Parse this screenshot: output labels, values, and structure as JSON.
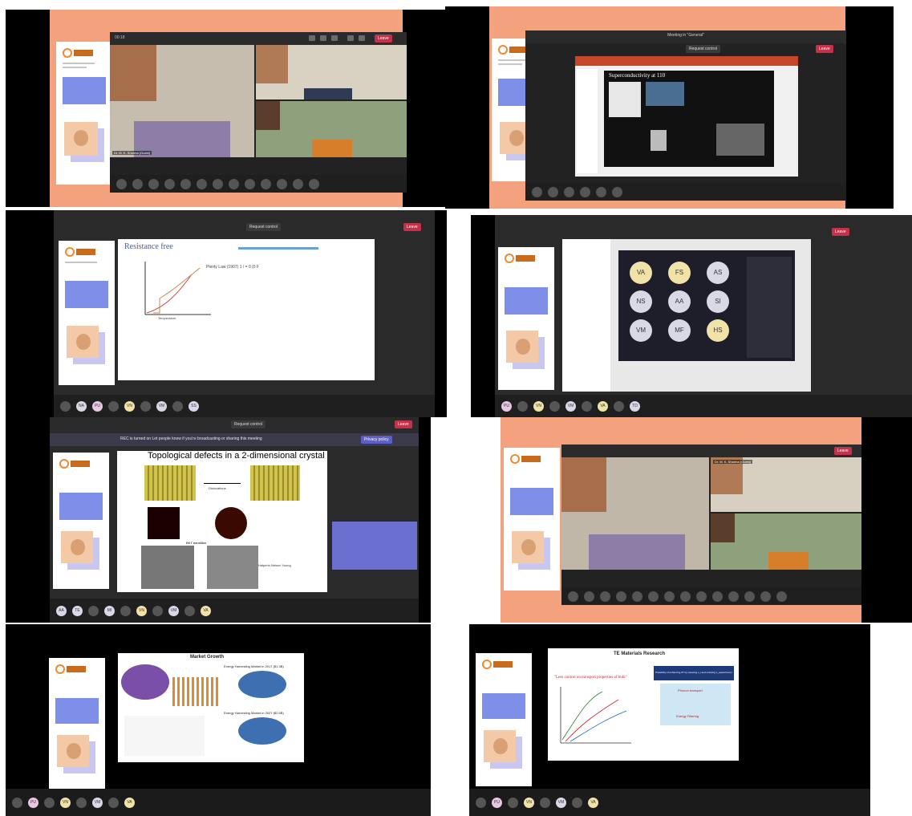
{
  "panels": {
    "p1": {
      "leave_label": "Leave",
      "presenter_tag": "Dr. M. K. Sharma (Guest)"
    },
    "p2": {
      "window_title": "Meeting in \"General\"",
      "request_control": "Request control",
      "leave_label": "Leave",
      "slide_title": "Superconductivity at 110"
    },
    "p3": {
      "request_control": "Request control",
      "leave_label": "Leave",
      "slide_title": "Resistance free",
      "slide_note": "Plenty Law (1907) 1 / = 0 (0 F",
      "x_axis": "Temperature"
    },
    "p4": {
      "leave_label": "Leave",
      "avatars": [
        "VA",
        "FS",
        "AS",
        "NS",
        "AA",
        "SI",
        "VM",
        "MF",
        "HS"
      ]
    },
    "p5": {
      "request_control": "Request control",
      "banner": "REC is turned on  Let people know if you're broadcasting or sharing this meeting",
      "privacy_button": "Privacy policy",
      "slide_title": "Topological defects in a 2-dimensional crystal",
      "arrow_label": "Dislocations",
      "transition_label": "BKT transition",
      "side_note": "Halperin Nelson Young"
    },
    "p6": {
      "leave_label": "Leave",
      "presenter_tag": "Dr. M. K. Sharma (Guest)"
    },
    "p7": {
      "slide_title": "Market Growth",
      "chart1_title": "Energy Harvesting Market in 2017 ($1.3B)",
      "chart2_title": "Energy Harvesting Market in 2027 ($2.6B)"
    },
    "p8": {
      "slide_title": "TE Materials Research",
      "quote": "\"Less control on transport properties of bulk\"",
      "box_text": "Possibility of enhancing ZT by reducing κ_l and reducing κ_e(electronic)",
      "diagram_label1": "Phonon transport",
      "diagram_label2": "Energy Filtering"
    }
  },
  "strip_avatars": {
    "p1": [
      "",
      "",
      "",
      "",
      "",
      "",
      "",
      "",
      "",
      "",
      "",
      "",
      ""
    ],
    "p2": [
      "",
      "",
      "",
      "",
      "",
      ""
    ],
    "p3": [
      "",
      "NA",
      "PU",
      "",
      "VN",
      "",
      "VM",
      "",
      "SS"
    ],
    "p4": [
      "PU",
      "",
      "VN",
      "",
      "VM",
      "",
      "VA",
      "",
      "TD"
    ],
    "p5": [
      "AA",
      "TE",
      "",
      "MI",
      "",
      "VN",
      "",
      "VM",
      "",
      "VA"
    ],
    "p6": [
      "",
      "",
      "",
      "",
      "",
      "",
      "",
      "",
      "",
      "",
      "",
      "",
      "",
      ""
    ],
    "p7": [
      "",
      "PU",
      "",
      "VN",
      "",
      "VM",
      "",
      "VA"
    ],
    "p8": [
      "",
      "PU",
      "",
      "VN",
      "",
      "VM",
      "",
      "VA"
    ]
  },
  "colors": {
    "peach": "#f4a27e",
    "poster_box": "#7f8ee6",
    "leave_red": "#c4314b",
    "teams_dark": "#1f1f1f"
  }
}
